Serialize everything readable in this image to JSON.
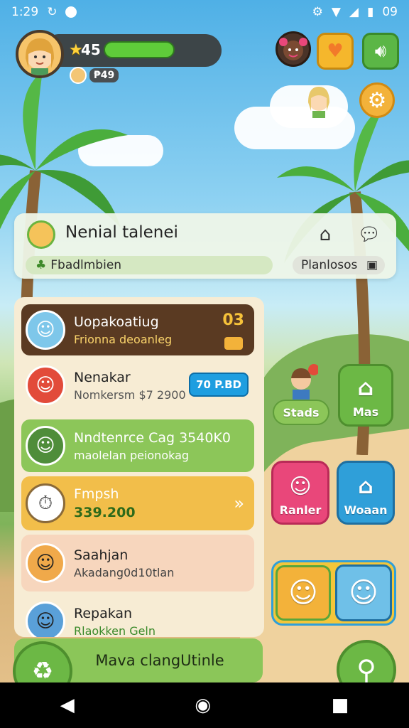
{
  "status_bar": {
    "time": "1:29",
    "battery_text": "09"
  },
  "hud": {
    "stars": "45",
    "sub_badge": "₱49"
  },
  "header_card": {
    "title": "Nenial talenei",
    "left_pill": "Fbadlmbien",
    "right_pill": "Planlosos"
  },
  "list": [
    {
      "title": "Uopakoatiug",
      "subtitle": "Frionna deoanleg",
      "badge": "03"
    },
    {
      "title": "Nenakar",
      "subtitle": "Nomkersm $7 2900",
      "badge": "70 P.BD"
    },
    {
      "title": "Nndtenrce Cag 3540K0",
      "subtitle": "maolelan peionokag"
    },
    {
      "title": "Fmpsh",
      "subtitle": "339.200"
    },
    {
      "title": "Saahjan",
      "subtitle": "Akadang0d10tlan"
    },
    {
      "title": "Repakan",
      "subtitle": "Rlaokken Geln"
    }
  ],
  "right_buttons": {
    "stads": "Stads",
    "mas": "Mas",
    "ranler": "Ranler",
    "woaan": "Woaan"
  },
  "bottom": {
    "label": "Mava clangUtinle"
  },
  "colors": {
    "accent_green": "#6cb845",
    "brown_row": "#5a3a22",
    "orange_row": "#f2be4a",
    "pink_btn": "#e9477a",
    "blue_btn": "#2f9fd9"
  }
}
